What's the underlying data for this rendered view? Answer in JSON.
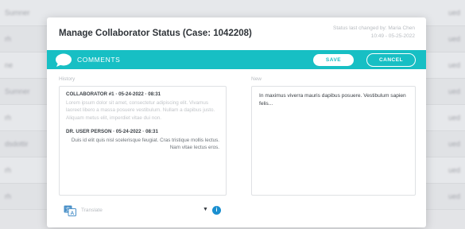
{
  "background": {
    "rows": [
      {
        "left": "Sumner",
        "right": "ued"
      },
      {
        "left": "rh",
        "right": "ued"
      },
      {
        "left": "ne",
        "right": "ued"
      },
      {
        "left": "Sumner",
        "right": "ued"
      },
      {
        "left": "rh",
        "right": "ued"
      },
      {
        "left": "dsdottir",
        "right": "ued"
      },
      {
        "left": "rh",
        "right": "ued"
      },
      {
        "left": "rh",
        "right": "ued"
      }
    ]
  },
  "modal": {
    "title": "Manage Collaborator Status (Case: 1042208)",
    "status_line1": "Status last changed by: Maria Chen",
    "status_line2": "10:49 - 05-25-2022"
  },
  "comments_bar": {
    "label": "COMMENTS",
    "save_label": "SAVE",
    "cancel_label": "CANCEL"
  },
  "history": {
    "label": "History",
    "entries": [
      {
        "header": "COLLABORATOR #1 · 05-24-2022 · 08:31",
        "body": "Lorem ipsum dolor sit amet, consectetur adipiscing elit. Vivamus laoreet libero a massa posuere vestibulum. Nullam a dapibus justo. Aliquam metus elit, imperdiet vitae dui non."
      },
      {
        "header": "DR. USER PERSON · 05-24-2022 · 08:31",
        "body": "Duis id elit quis nisl scelerisque feugiat. Cras tristique mollis lectus. Nam vitae lectus eros."
      }
    ]
  },
  "new_comment": {
    "label": "New",
    "value": "In maximus viverra mauris dapibus posuere. Vestibulum sapien felis..."
  },
  "translate": {
    "label": "Translate",
    "icon": "translate-icon",
    "info_icon": "info-icon",
    "info_glyph": "i"
  },
  "colors": {
    "accent": "#17bfc4",
    "info": "#1a8fd0"
  }
}
